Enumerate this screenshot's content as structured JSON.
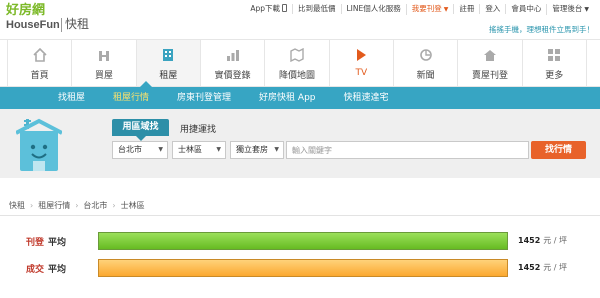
{
  "logo": {
    "main": "好房網",
    "sub": "HouseFun",
    "tag": "快租"
  },
  "toplinks": [
    {
      "label": "App下載",
      "style": "normal",
      "icon": "phone-icon"
    },
    {
      "label": "比到最低價",
      "style": "normal"
    },
    {
      "label": "LINE個人化服務",
      "style": "normal"
    },
    {
      "label": "我要刊登",
      "style": "red",
      "caret": true
    },
    {
      "label": "註冊",
      "style": "normal"
    },
    {
      "label": "登入",
      "style": "normal"
    },
    {
      "label": "會員中心",
      "style": "normal"
    },
    {
      "label": "管理後台",
      "style": "normal",
      "caret": true
    }
  ],
  "slogan": "搖搖手機，理想租件立馬到手！",
  "mainnav": [
    {
      "label": "首頁",
      "icon": "home-icon"
    },
    {
      "label": "買屋",
      "icon": "buy-house-icon"
    },
    {
      "label": "租屋",
      "icon": "rent-building-icon",
      "active": true
    },
    {
      "label": "實價登錄",
      "icon": "bar-chart-icon"
    },
    {
      "label": "降價地圖",
      "icon": "map-icon"
    },
    {
      "label": "TV",
      "icon": "play-icon",
      "tv": true
    },
    {
      "label": "新聞",
      "icon": "news-icon"
    },
    {
      "label": "賣屋刊登",
      "icon": "sell-house-icon"
    },
    {
      "label": "更多",
      "icon": "grid-icon"
    }
  ],
  "subnav": [
    {
      "label": "找租屋"
    },
    {
      "label": "租屋行情",
      "active": true
    },
    {
      "label": "房東刊登管理"
    },
    {
      "label": "好房快租 App"
    },
    {
      "label": "快租速達宅"
    }
  ],
  "search": {
    "tab_active": "用區域找",
    "tab_other": "用捷運找",
    "city": "台北市",
    "district": "士林區",
    "type": "獨立套房",
    "keyword_placeholder": "輸入關鍵字",
    "button": "找行情"
  },
  "breadcrumb": [
    "快租",
    "租屋行情",
    "台北市",
    "士林區"
  ],
  "prices": [
    {
      "k1": "刊登",
      "k2": "平均",
      "value": "1452",
      "unit": "元 / 坪",
      "bar_color": "#7cc83a"
    },
    {
      "k1": "成交",
      "k2": "平均",
      "value": "1452",
      "unit": "元 / 坪",
      "bar_color": "#fbb040"
    }
  ],
  "colors": {
    "brand_green": "#7cb928",
    "nav_blue": "#37a5c3",
    "accent_orange": "#e8622a"
  }
}
